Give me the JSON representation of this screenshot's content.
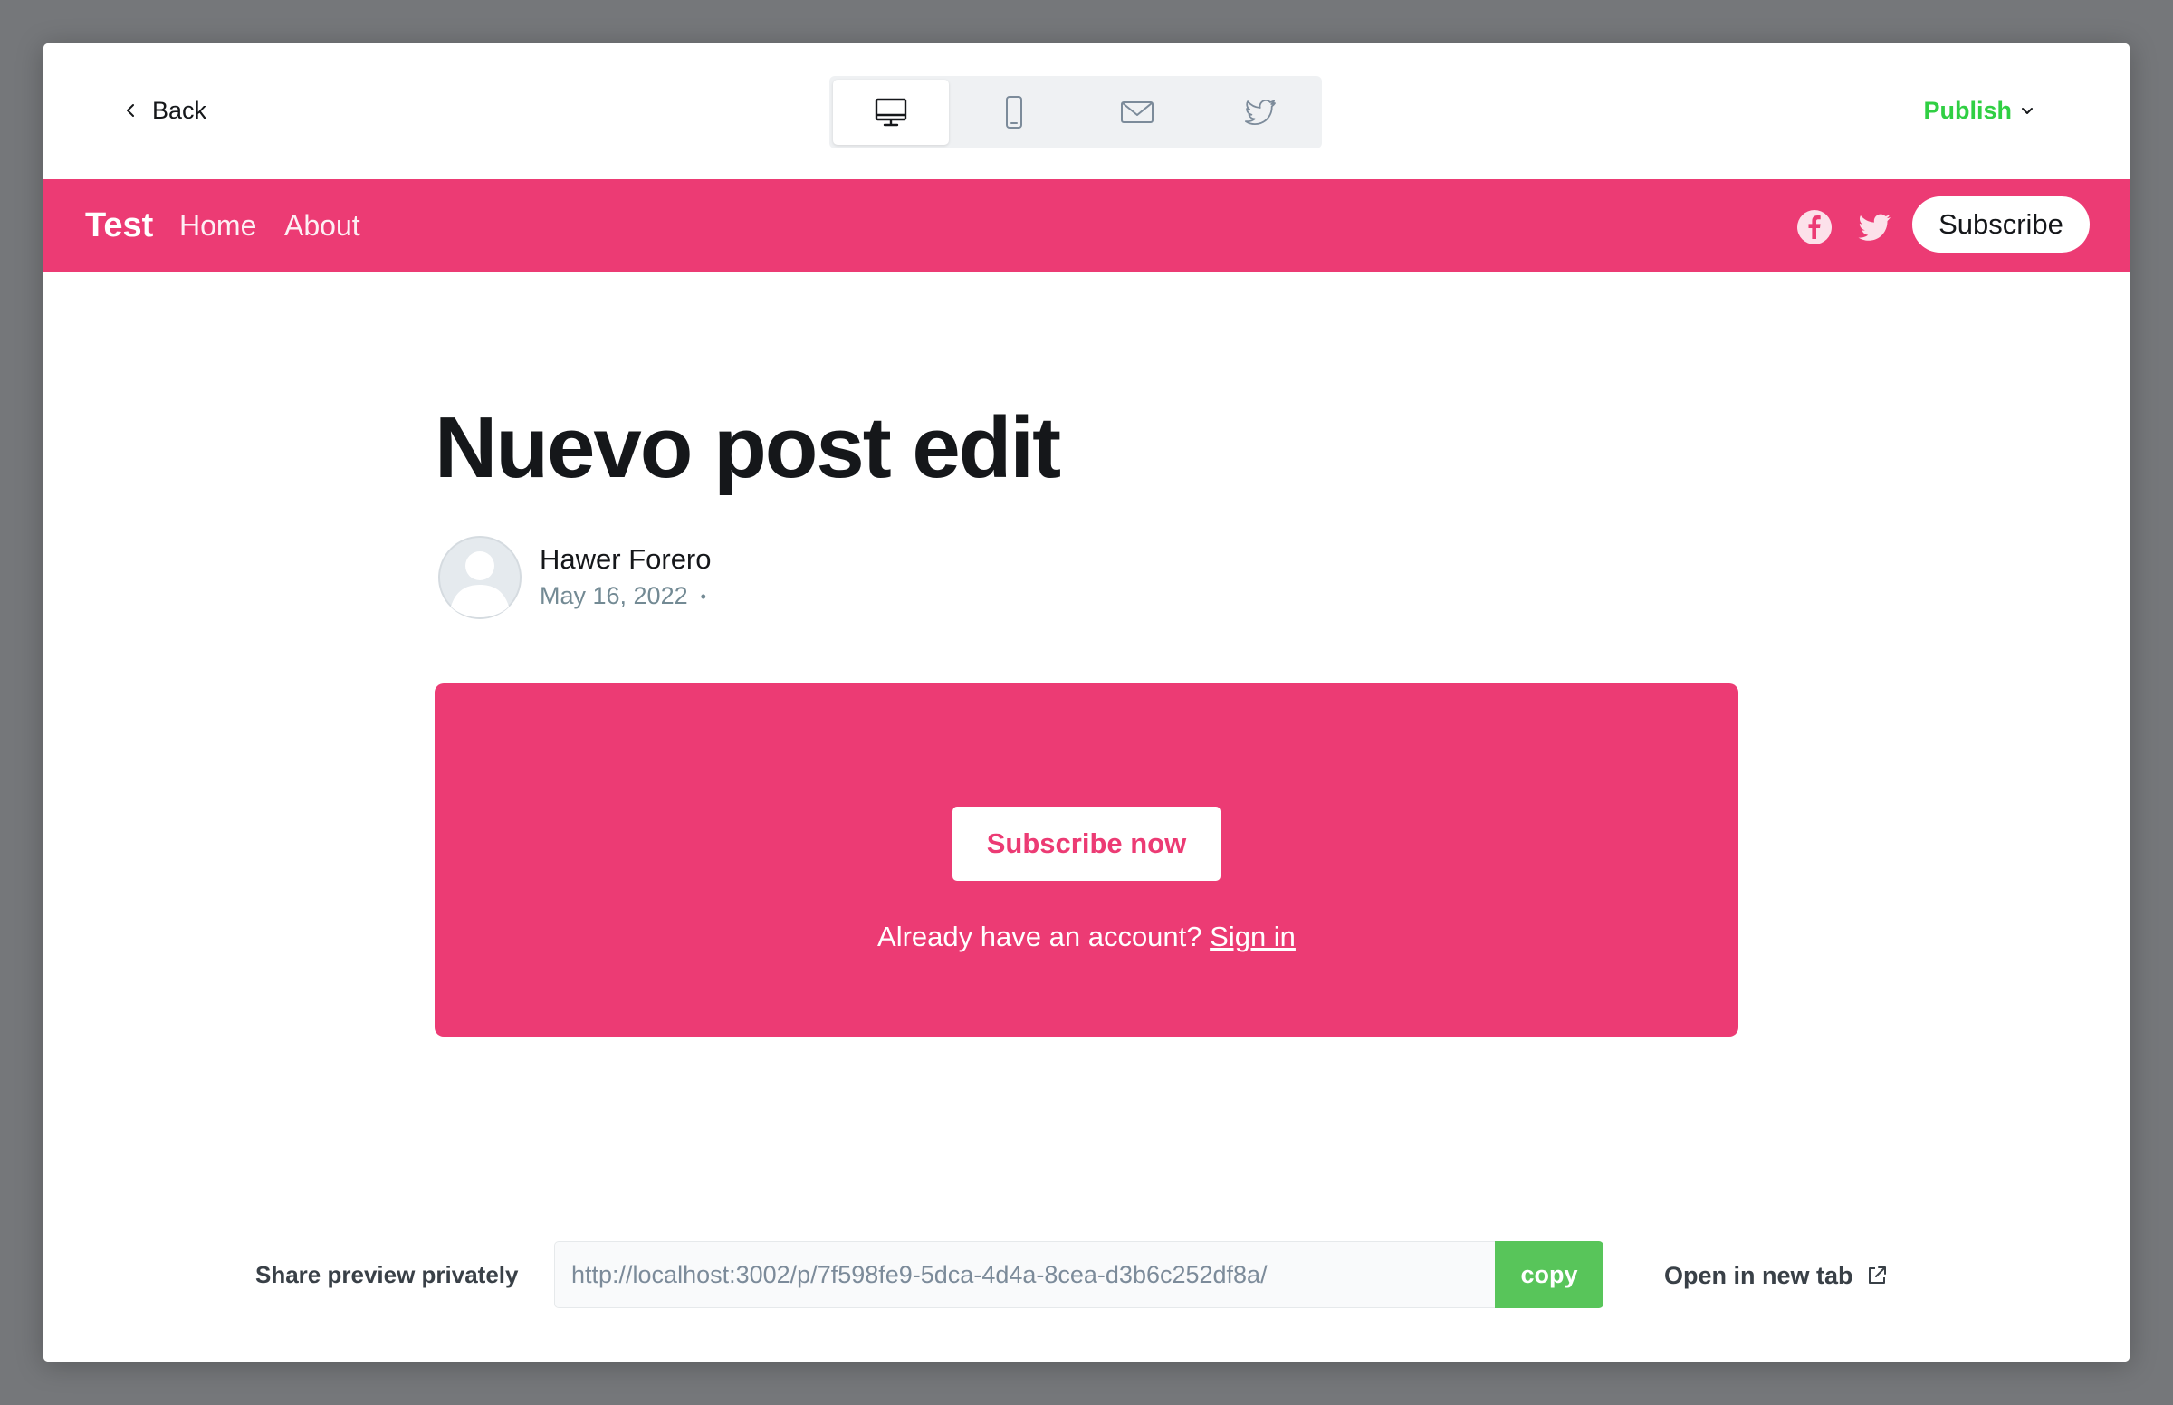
{
  "toolbar": {
    "back_label": "Back",
    "publish_label": "Publish",
    "devices": [
      {
        "name": "desktop",
        "icon": "desktop-icon",
        "active": true
      },
      {
        "name": "mobile",
        "icon": "mobile-icon",
        "active": false
      },
      {
        "name": "email",
        "icon": "envelope-icon",
        "active": false
      },
      {
        "name": "twitter",
        "icon": "twitter-icon",
        "active": false
      }
    ]
  },
  "site": {
    "brand": "Test",
    "nav": [
      {
        "label": "Home"
      },
      {
        "label": "About"
      }
    ],
    "social_icons": [
      "facebook-icon",
      "twitter-icon"
    ],
    "subscribe_label": "Subscribe"
  },
  "post": {
    "title": "Nuevo post edit",
    "author": "Hawer Forero",
    "date": "May 16, 2022",
    "date_separator": "•"
  },
  "cta": {
    "button_label": "Subscribe now",
    "note_text": "Already have an account?",
    "signin_label": "Sign in"
  },
  "footer": {
    "share_label": "Share preview privately",
    "url_value": "http://localhost:3002/p/7f598fe9-5dca-4d4a-8cea-d3b6c252df8a/",
    "copy_label": "copy",
    "open_tab_label": "Open in new tab"
  },
  "colors": {
    "accent": "#ec3b74",
    "publish_green": "#30cf43",
    "copy_green": "#58c55a",
    "backdrop": "#75777a"
  }
}
